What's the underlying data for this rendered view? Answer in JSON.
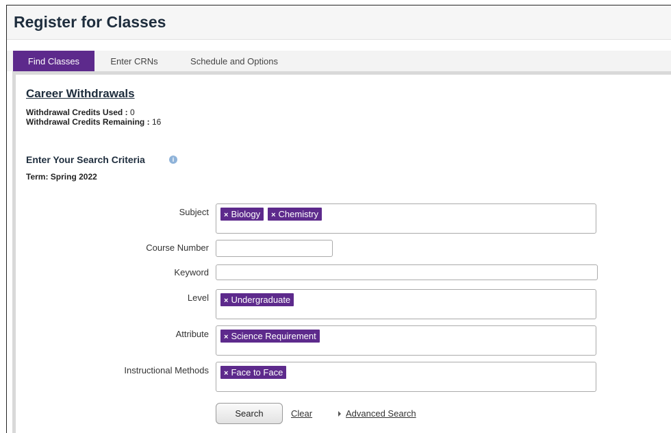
{
  "header": {
    "title": "Register for Classes"
  },
  "tabs": [
    {
      "label": "Find Classes",
      "active": true
    },
    {
      "label": "Enter CRNs",
      "active": false
    },
    {
      "label": "Schedule and Options",
      "active": false
    }
  ],
  "career": {
    "heading": "Career Withdrawals",
    "used_label": "Withdrawal Credits Used :",
    "used_value": "0",
    "remaining_label": "Withdrawal Credits Remaining :",
    "remaining_value": "16"
  },
  "search": {
    "heading": "Enter Your Search Criteria",
    "info_icon": "info-icon",
    "term": "Term: Spring 2022",
    "fields": {
      "subject": {
        "label": "Subject",
        "chips": [
          "Biology",
          "Chemistry"
        ]
      },
      "course_number": {
        "label": "Course Number",
        "value": ""
      },
      "keyword": {
        "label": "Keyword",
        "value": ""
      },
      "level": {
        "label": "Level",
        "chips": [
          "Undergraduate"
        ]
      },
      "attribute": {
        "label": "Attribute",
        "chips": [
          "Science Requirement"
        ]
      },
      "instructional_methods": {
        "label": "Instructional Methods",
        "chips": [
          "Face to Face"
        ]
      }
    },
    "chip_remove_glyph": "×",
    "search_button": "Search",
    "clear_link": "Clear",
    "advanced_link": "Advanced Search"
  },
  "colors": {
    "accent": "#5d2a8c",
    "title_text": "#1e2d3d",
    "info_icon": "#8fb3d9"
  }
}
